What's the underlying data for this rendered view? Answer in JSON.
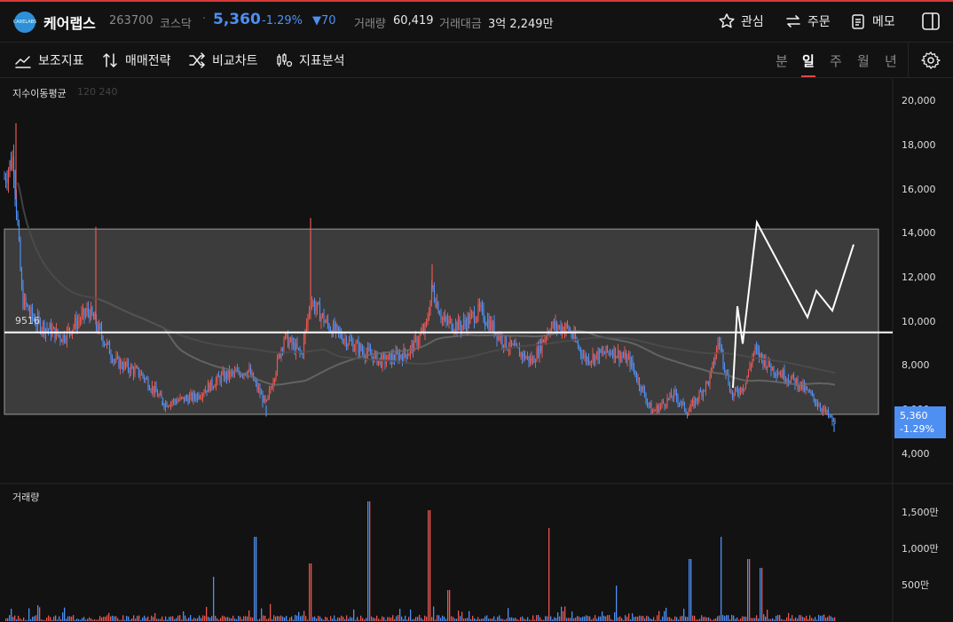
{
  "header": {
    "name": "케어랩스",
    "logo_text": "CARELABS",
    "code": "263700",
    "market": "코스닥",
    "separator": "·",
    "price": "5,360",
    "change_pct": "-1.29%",
    "change_abs": "▼70",
    "volume_label": "거래량",
    "volume_value": "60,419",
    "amount_label": "거래대금",
    "amount_value": "3억 2,249만",
    "watch_label": "관심",
    "order_label": "주문",
    "memo_label": "메모"
  },
  "toolbar": {
    "indicator_label": "보조지표",
    "strategy_label": "매매전략",
    "compare_label": "비교차트",
    "analysis_label": "지표분석",
    "periods": [
      "분",
      "일",
      "주",
      "월",
      "년"
    ],
    "active_period": "일"
  },
  "chart": {
    "indicator_name": "지수이동평균",
    "indicator_params": "120 240",
    "price_axis_ticks": [
      "20,000",
      "18,000",
      "16,000",
      "14,000",
      "12,000",
      "10,000",
      "8,000",
      "6,000",
      "4,000"
    ],
    "current_price_tag": "5,360",
    "current_change_tag": "-1.29%",
    "level_line_label": "9516",
    "box_range": [
      5800,
      14200
    ],
    "level_value": 9516,
    "volume_title": "거래량",
    "volume_axis_ticks": [
      "1,500만",
      "1,000만",
      "500만"
    ]
  },
  "colors": {
    "up": "#e8574f",
    "down": "#4e8ff2",
    "accent_red": "#d63c3c"
  }
}
